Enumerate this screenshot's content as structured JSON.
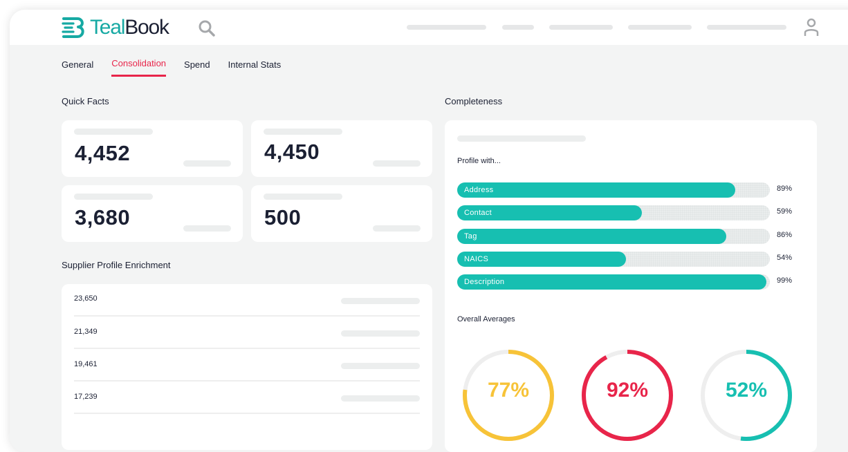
{
  "brand": {
    "name_part1": "Teal",
    "name_part2": "Book",
    "accent": "#16a9a3",
    "dark": "#1b2033"
  },
  "tabs": [
    {
      "label": "General",
      "active": false
    },
    {
      "label": "Consolidation",
      "active": true
    },
    {
      "label": "Spend",
      "active": false
    },
    {
      "label": "Internal Stats",
      "active": false
    }
  ],
  "quick_facts": {
    "title": "Quick Facts",
    "values": [
      "4,452",
      "4,450",
      "3,680",
      "500"
    ]
  },
  "enrichment": {
    "title": "Supplier Profile Enrichment",
    "rows": [
      "23,650",
      "21,349",
      "19,461",
      "17,239"
    ]
  },
  "completeness": {
    "title": "Completeness",
    "profile_label": "Profile with...",
    "bars": [
      {
        "label": "Address",
        "value": 89,
        "pct": "89%"
      },
      {
        "label": "Contact",
        "value": 59,
        "pct": "59%"
      },
      {
        "label": "Tag",
        "value": 86,
        "pct": "86%"
      },
      {
        "label": "NAICS",
        "value": 54,
        "pct": "54%"
      },
      {
        "label": "Description",
        "value": 99,
        "pct": "99%"
      }
    ],
    "bar_color": "#17bfb1",
    "averages_label": "Overall Averages",
    "rings": [
      {
        "text": "77%",
        "value": 77,
        "color": "#f7c338"
      },
      {
        "text": "92%",
        "value": 92,
        "color": "#e8254a"
      },
      {
        "text": "52%",
        "value": 52,
        "color": "#17bfb1"
      }
    ]
  },
  "icons": {
    "search": "search-icon",
    "user": "user-icon",
    "logo": "tealbook-logo-icon"
  }
}
